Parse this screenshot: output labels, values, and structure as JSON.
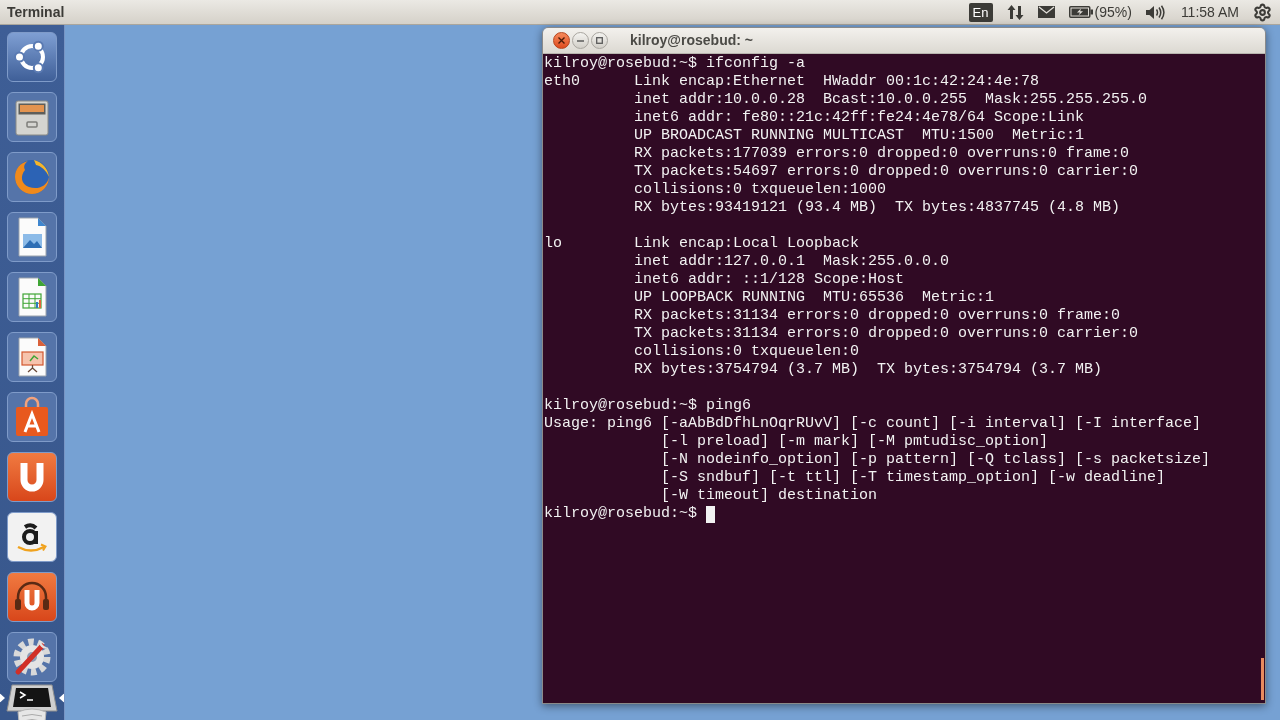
{
  "top_panel": {
    "app_title": "Terminal",
    "indicators": [
      {
        "kind": "keyboard",
        "label": "En"
      },
      {
        "kind": "network"
      },
      {
        "kind": "mail"
      },
      {
        "kind": "battery",
        "label": "(95%)"
      },
      {
        "kind": "sound"
      },
      {
        "kind": "clock",
        "label": "11:58 AM"
      },
      {
        "kind": "session"
      }
    ]
  },
  "launcher": [
    {
      "kind": "home",
      "running": false,
      "focused": false
    },
    {
      "kind": "files",
      "running": false,
      "focused": false
    },
    {
      "kind": "browser",
      "running": false,
      "focused": false
    },
    {
      "kind": "drawing",
      "running": false,
      "focused": false
    },
    {
      "kind": "spreadsheet",
      "running": false,
      "focused": false
    },
    {
      "kind": "presentation",
      "running": false,
      "focused": false
    },
    {
      "kind": "software",
      "running": false,
      "focused": false
    },
    {
      "kind": "cloud",
      "running": false,
      "focused": false
    },
    {
      "kind": "shop",
      "running": false,
      "focused": false
    },
    {
      "kind": "music",
      "running": false,
      "focused": false
    },
    {
      "kind": "settings",
      "running": false,
      "focused": false
    },
    {
      "kind": "terminal",
      "running": true,
      "focused": true
    },
    {
      "kind": "trash",
      "running": false,
      "focused": false
    }
  ],
  "terminal": {
    "title": "kilroy@rosebud: ~",
    "output": [
      {
        "kind": "command",
        "text": "kilroy@rosebud:~$ ifconfig -a"
      },
      {
        "kind": "interface",
        "name": "eth0",
        "lines": [
          "Link encap:Ethernet  HWaddr 00:1c:42:24:4e:78",
          "inet addr:10.0.0.28  Bcast:10.0.0.255  Mask:255.255.255.0",
          "inet6 addr: fe80::21c:42ff:fe24:4e78/64 Scope:Link",
          "UP BROADCAST RUNNING MULTICAST  MTU:1500  Metric:1",
          "RX packets:177039 errors:0 dropped:0 overruns:0 frame:0",
          "TX packets:54697 errors:0 dropped:0 overruns:0 carrier:0",
          "collisions:0 txqueuelen:1000",
          "RX bytes:93419121 (93.4 MB)  TX bytes:4837745 (4.8 MB)"
        ]
      },
      {
        "kind": "interface",
        "name": "lo",
        "lines": [
          "Link encap:Local Loopback",
          "inet addr:127.0.0.1  Mask:255.0.0.0",
          "inet6 addr: ::1/128 Scope:Host",
          "UP LOOPBACK RUNNING  MTU:65536  Metric:1",
          "RX packets:31134 errors:0 dropped:0 overruns:0 frame:0",
          "TX packets:31134 errors:0 dropped:0 overruns:0 carrier:0",
          "collisions:0 txqueuelen:0",
          "RX bytes:3754794 (3.7 MB)  TX bytes:3754794 (3.7 MB)"
        ]
      },
      {
        "kind": "command",
        "text": "kilroy@rosebud:~$ ping6"
      },
      {
        "kind": "usage",
        "label": "Usage: ping6",
        "lines": [
          "[-aAbBdDfhLnOqrRUvV] [-c count] [-i interval] [-I interface]",
          "[-l preload] [-m mark] [-M pmtudisc_option]",
          "[-N nodeinfo_option] [-p pattern] [-Q tclass] [-s packetsize]",
          "[-S sndbuf] [-t ttl] [-T timestamp_option] [-w deadline]",
          "[-W timeout] destination"
        ]
      }
    ],
    "prompt": "kilroy@rosebud:~$",
    "cursor": true
  }
}
